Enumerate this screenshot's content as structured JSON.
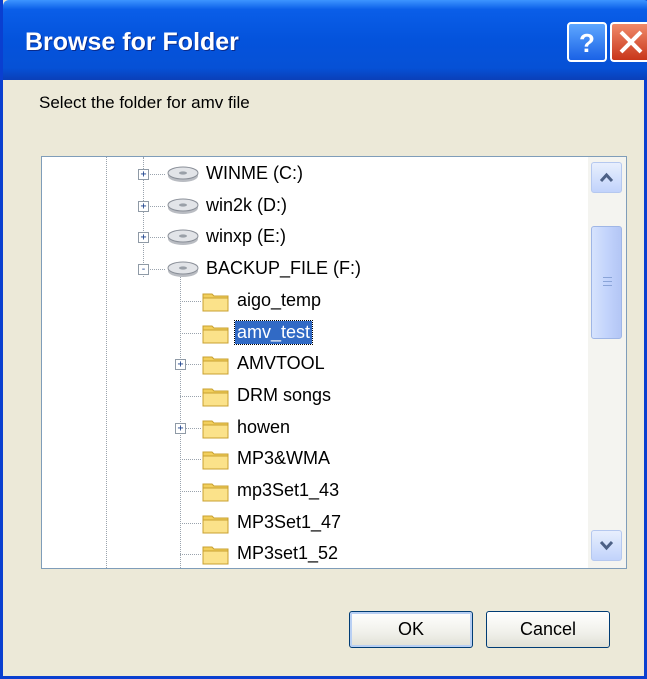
{
  "window": {
    "title": "Browse for Folder",
    "help_icon": "question-mark-icon",
    "close_icon": "close-x-icon"
  },
  "prompt": "Select the folder for amv file",
  "tree": {
    "drives": [
      {
        "label": "WINME (C:)",
        "icon": "drive-icon",
        "expander": "+"
      },
      {
        "label": "win2k (D:)",
        "icon": "drive-icon",
        "expander": "+"
      },
      {
        "label": "winxp (E:)",
        "icon": "drive-icon",
        "expander": "+"
      },
      {
        "label": "BACKUP_FILE (F:)",
        "icon": "drive-icon",
        "expander": "-"
      }
    ],
    "folders": [
      {
        "label": "aigo_temp",
        "icon": "folder-icon",
        "expander": ""
      },
      {
        "label": "amv_test",
        "icon": "folder-icon",
        "expander": "",
        "selected": true
      },
      {
        "label": "AMVTOOL",
        "icon": "folder-icon",
        "expander": "+"
      },
      {
        "label": "DRM songs",
        "icon": "folder-icon",
        "expander": ""
      },
      {
        "label": "howen",
        "icon": "folder-icon",
        "expander": "+"
      },
      {
        "label": "MP3&WMA",
        "icon": "folder-icon",
        "expander": ""
      },
      {
        "label": "mp3Set1_43",
        "icon": "folder-icon",
        "expander": ""
      },
      {
        "label": "MP3Set1_47",
        "icon": "folder-icon",
        "expander": ""
      },
      {
        "label": "MP3set1_52",
        "icon": "folder-icon",
        "expander": ""
      }
    ]
  },
  "buttons": {
    "ok": "OK",
    "cancel": "Cancel"
  },
  "colors": {
    "titlebar": "#0453dc",
    "selection": "#316ac5",
    "dialog_bg": "#ece9d8"
  }
}
